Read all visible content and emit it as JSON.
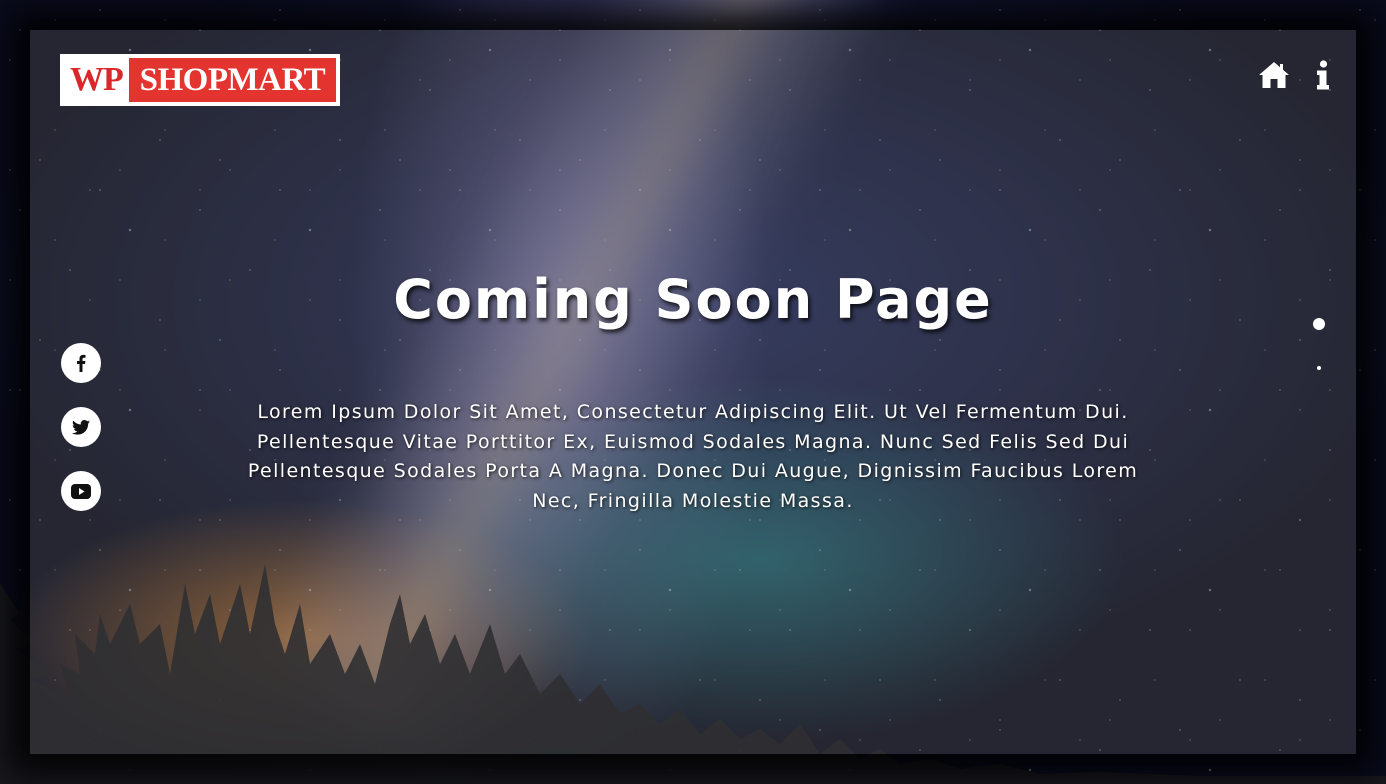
{
  "logo": {
    "prefix": "WP",
    "name": "SHOPMART"
  },
  "header": {
    "icons": [
      "home-icon",
      "info-icon"
    ]
  },
  "main": {
    "title": "Coming Soon Page",
    "description": "Lorem Ipsum Dolor Sit Amet, Consectetur Adipiscing Elit. Ut Vel Fermentum Dui. Pellentesque Vitae Porttitor Ex, Euismod Sodales Magna. Nunc Sed Felis Sed Dui Pellentesque Sodales Porta A Magna. Donec Dui Augue, Dignissim Faucibus Lorem Nec, Fringilla Molestie Massa."
  },
  "social": {
    "icons": [
      "facebook-icon",
      "twitter-icon",
      "youtube-icon"
    ]
  },
  "pagination": {
    "count": 2,
    "active_index": 0
  },
  "colors": {
    "brand_red": "#e3342f",
    "text": "#ffffff",
    "icon_dark": "#111111"
  }
}
